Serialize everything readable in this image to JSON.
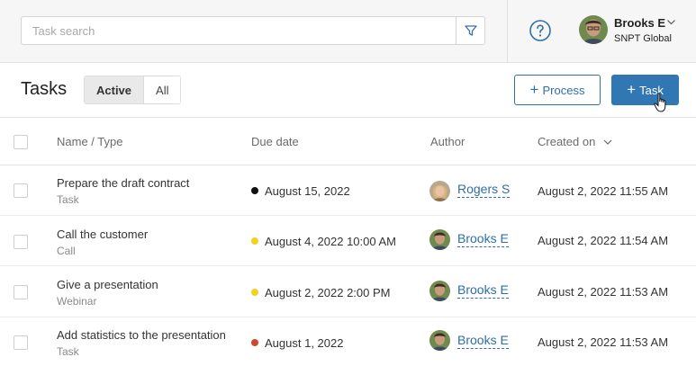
{
  "header": {
    "search_placeholder": "Task search",
    "user_name": "Brooks E",
    "user_org": "SNPT Global"
  },
  "toolbar": {
    "title": "Tasks",
    "filter_active": "Active",
    "filter_all": "All",
    "process_label": "Process",
    "task_label": "Task"
  },
  "table": {
    "columns": {
      "name": "Name / Type",
      "due": "Due date",
      "author": "Author",
      "created": "Created on"
    },
    "rows": [
      {
        "name": "Prepare the draft contract",
        "type": "Task",
        "due": "August 15, 2022",
        "due_color": "#111111",
        "author": "Rogers S",
        "created": "August 2, 2022 11:55 AM"
      },
      {
        "name": "Call the customer",
        "type": "Call",
        "due": "August 4, 2022 10:00 AM",
        "due_color": "#f2d21b",
        "author": "Brooks E",
        "created": "August 2, 2022 11:54 AM"
      },
      {
        "name": "Give a presentation",
        "type": "Webinar",
        "due": "August 2, 2022 2:00 PM",
        "due_color": "#f2d21b",
        "author": "Brooks E",
        "created": "August 2, 2022 11:53 AM"
      },
      {
        "name": "Add statistics to the presentation",
        "type": "Task",
        "due": "August 1, 2022",
        "due_color": "#d2462a",
        "author": "Brooks E",
        "created": "August 2, 2022 11:53 AM"
      }
    ]
  },
  "colors": {
    "accent": "#3177b3",
    "link": "#2e6fa7"
  },
  "icons": [
    "filter-icon",
    "help-icon",
    "chevron-down-icon",
    "plus-icon",
    "hand-cursor-icon"
  ]
}
